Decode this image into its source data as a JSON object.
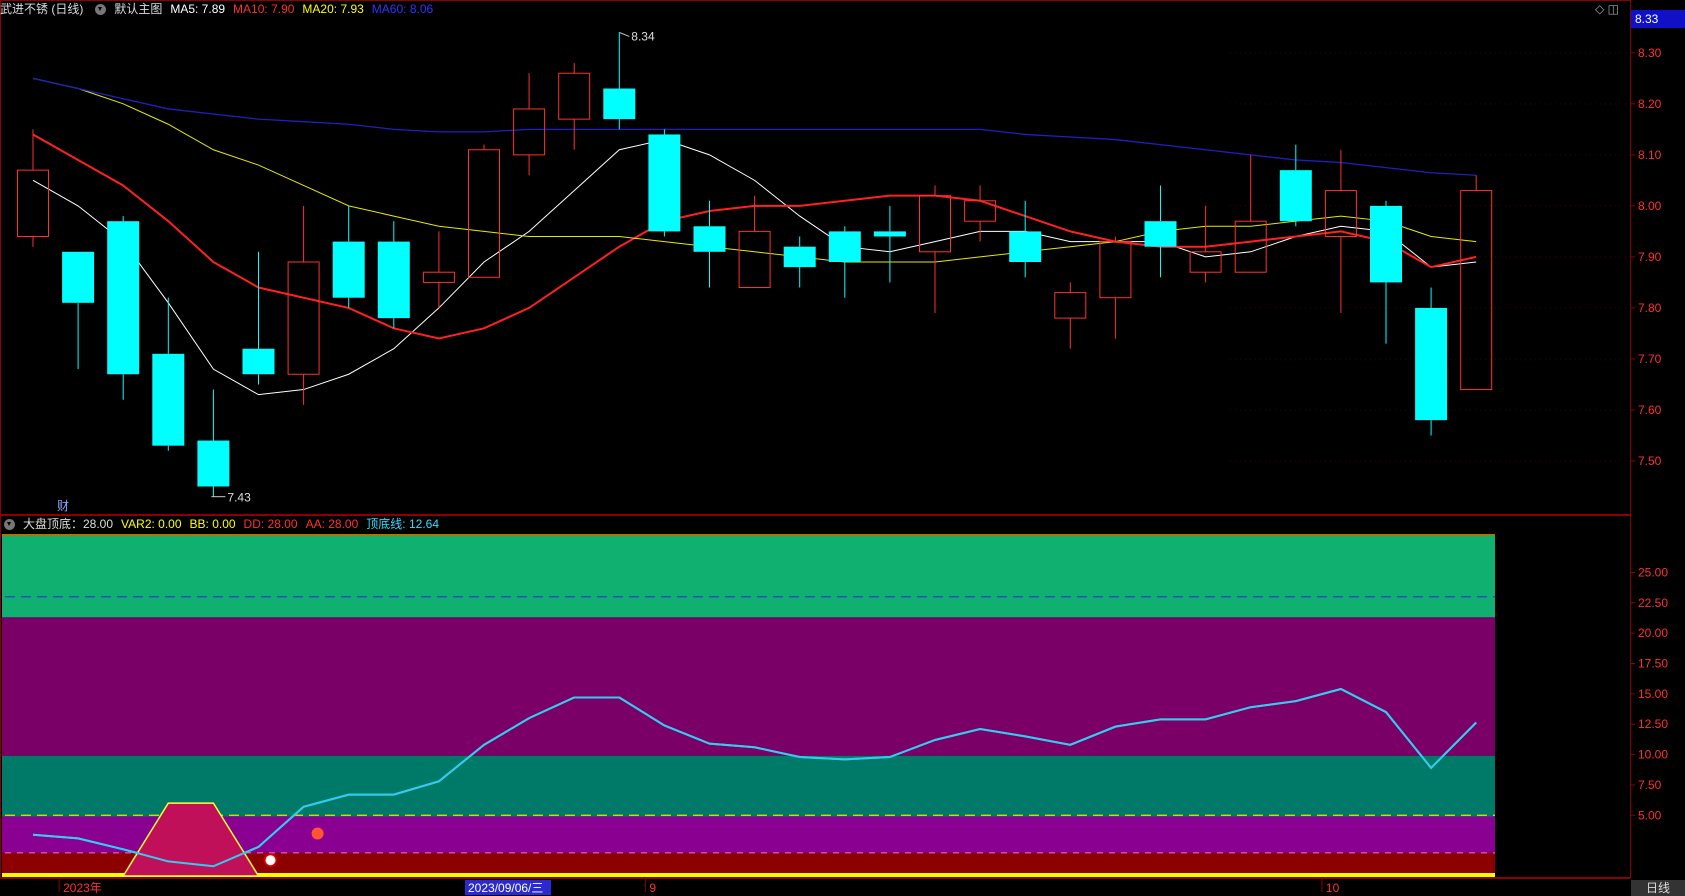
{
  "main_header": {
    "stock": "武进不锈 (日线)",
    "chart_name": "默认主图",
    "indicators": [
      {
        "label": "MA5: 7.89",
        "color": "#ffffff"
      },
      {
        "label": "MA10: 7.90",
        "color": "#ff3030"
      },
      {
        "label": "MA20: 7.93",
        "color": "#ffff00"
      },
      {
        "label": "MA60: 8.06",
        "color": "#3333ff"
      }
    ]
  },
  "sub_header": {
    "name": "大盘顶底：28.00",
    "indicators": [
      {
        "label": "VAR2: 0.00",
        "color": "#ffff00"
      },
      {
        "label": "BB: 0.00",
        "color": "#ffff00"
      },
      {
        "label": "DD: 28.00",
        "color": "#ff3030"
      },
      {
        "label": "AA: 28.00",
        "color": "#ff3030"
      },
      {
        "label": "顶底线: 12.64",
        "color": "#33ddff"
      }
    ]
  },
  "top_right_icons": "◇ ◫",
  "current_price_tag": "8.33",
  "bottom_right_label": "日线",
  "cai_label": "财",
  "colors": {
    "up": "#ff3030",
    "down": "#00ffff",
    "ma5": "#ffffff",
    "ma10": "#ff2020",
    "ma20": "#e8e800",
    "ma60": "#2020c0",
    "osc_line": "#33ccee",
    "band_top": "#10b070",
    "band_purple": "#7a0068",
    "band_teal": "#007a68",
    "band_magenta": "#8a0090",
    "band_bottom": "#8c0000"
  },
  "chart_data": [
    {
      "type": "candlestick",
      "title": "",
      "y_ticks": [
        "8.30",
        "8.20",
        "8.10",
        "8.00",
        "7.90",
        "7.80",
        "7.70",
        "7.60",
        "7.50"
      ],
      "ylim": [
        7.4,
        8.38
      ],
      "annotations": {
        "high": "8.34",
        "low": "7.43"
      },
      "candles": [
        {
          "o": 7.94,
          "h": 8.15,
          "l": 7.92,
          "c": 8.07
        },
        {
          "o": 7.91,
          "h": 7.91,
          "l": 7.68,
          "c": 7.81
        },
        {
          "o": 7.97,
          "h": 7.98,
          "l": 7.62,
          "c": 7.67
        },
        {
          "o": 7.71,
          "h": 7.82,
          "l": 7.52,
          "c": 7.53
        },
        {
          "o": 7.54,
          "h": 7.64,
          "l": 7.43,
          "c": 7.45
        },
        {
          "o": 7.72,
          "h": 7.91,
          "l": 7.65,
          "c": 7.67
        },
        {
          "o": 7.67,
          "h": 8.0,
          "l": 7.61,
          "c": 7.89
        },
        {
          "o": 7.93,
          "h": 8.0,
          "l": 7.8,
          "c": 7.82
        },
        {
          "o": 7.93,
          "h": 7.97,
          "l": 7.76,
          "c": 7.78
        },
        {
          "o": 7.85,
          "h": 7.95,
          "l": 7.8,
          "c": 7.87
        },
        {
          "o": 7.86,
          "h": 8.12,
          "l": 7.86,
          "c": 8.11
        },
        {
          "o": 8.1,
          "h": 8.26,
          "l": 8.06,
          "c": 8.19
        },
        {
          "o": 8.17,
          "h": 8.28,
          "l": 8.11,
          "c": 8.26
        },
        {
          "o": 8.23,
          "h": 8.34,
          "l": 8.15,
          "c": 8.17
        },
        {
          "o": 8.14,
          "h": 8.15,
          "l": 7.94,
          "c": 7.95
        },
        {
          "o": 7.96,
          "h": 8.01,
          "l": 7.84,
          "c": 7.91
        },
        {
          "o": 7.84,
          "h": 8.02,
          "l": 7.84,
          "c": 7.95
        },
        {
          "o": 7.92,
          "h": 7.94,
          "l": 7.84,
          "c": 7.88
        },
        {
          "o": 7.95,
          "h": 7.96,
          "l": 7.82,
          "c": 7.89
        },
        {
          "o": 7.95,
          "h": 8.0,
          "l": 7.85,
          "c": 7.94
        },
        {
          "o": 7.91,
          "h": 8.04,
          "l": 7.79,
          "c": 8.02
        },
        {
          "o": 7.97,
          "h": 8.04,
          "l": 7.93,
          "c": 8.01
        },
        {
          "o": 7.95,
          "h": 8.01,
          "l": 7.86,
          "c": 7.89
        },
        {
          "o": 7.78,
          "h": 7.85,
          "l": 7.72,
          "c": 7.83
        },
        {
          "o": 7.82,
          "h": 7.94,
          "l": 7.74,
          "c": 7.93
        },
        {
          "o": 7.97,
          "h": 8.04,
          "l": 7.86,
          "c": 7.92
        },
        {
          "o": 7.87,
          "h": 8.0,
          "l": 7.85,
          "c": 7.91
        },
        {
          "o": 7.87,
          "h": 8.1,
          "l": 7.87,
          "c": 7.97
        },
        {
          "o": 8.07,
          "h": 8.12,
          "l": 7.96,
          "c": 7.97
        },
        {
          "o": 7.94,
          "h": 8.11,
          "l": 7.79,
          "c": 8.03
        },
        {
          "o": 8.0,
          "h": 8.01,
          "l": 7.73,
          "c": 7.85
        },
        {
          "o": 7.8,
          "h": 7.84,
          "l": 7.55,
          "c": 7.58
        },
        {
          "o": 7.64,
          "h": 8.06,
          "l": 7.64,
          "c": 8.03
        }
      ],
      "series": [
        {
          "name": "MA5",
          "values": [
            8.05,
            8.0,
            7.93,
            7.81,
            7.68,
            7.63,
            7.64,
            7.67,
            7.72,
            7.8,
            7.89,
            7.95,
            8.03,
            8.11,
            8.13,
            8.1,
            8.05,
            7.98,
            7.92,
            7.91,
            7.93,
            7.95,
            7.95,
            7.93,
            7.93,
            7.93,
            7.9,
            7.91,
            7.94,
            7.96,
            7.95,
            7.88,
            7.89
          ]
        },
        {
          "name": "MA10",
          "values": [
            8.14,
            8.09,
            8.04,
            7.97,
            7.89,
            7.84,
            7.82,
            7.8,
            7.76,
            7.74,
            7.76,
            7.8,
            7.86,
            7.92,
            7.97,
            7.99,
            8.0,
            8.0,
            8.01,
            8.02,
            8.02,
            8.01,
            7.98,
            7.95,
            7.93,
            7.92,
            7.92,
            7.93,
            7.94,
            7.95,
            7.93,
            7.88,
            7.9
          ]
        },
        {
          "name": "MA20",
          "values": [
            8.25,
            8.23,
            8.2,
            8.16,
            8.11,
            8.08,
            8.04,
            8.0,
            7.98,
            7.96,
            7.95,
            7.94,
            7.94,
            7.94,
            7.93,
            7.92,
            7.91,
            7.9,
            7.89,
            7.89,
            7.89,
            7.9,
            7.91,
            7.92,
            7.93,
            7.95,
            7.96,
            7.96,
            7.97,
            7.98,
            7.97,
            7.94,
            7.93
          ]
        },
        {
          "name": "MA60",
          "values": [
            8.25,
            8.23,
            8.21,
            8.19,
            8.18,
            8.17,
            8.165,
            8.16,
            8.15,
            8.145,
            8.145,
            8.15,
            8.15,
            8.15,
            8.15,
            8.15,
            8.15,
            8.15,
            8.15,
            8.15,
            8.15,
            8.15,
            8.14,
            8.135,
            8.13,
            8.12,
            8.11,
            8.1,
            8.09,
            8.085,
            8.075,
            8.065,
            8.06
          ]
        }
      ]
    },
    {
      "type": "line",
      "title": "",
      "y_ticks": [
        "25.00",
        "22.50",
        "20.00",
        "17.50",
        "15.00",
        "12.50",
        "10.00",
        "7.50",
        "5.00"
      ],
      "ylim": [
        0,
        28
      ],
      "bands": [
        {
          "from": 21.3,
          "to": 28,
          "color": "#10b070"
        },
        {
          "from": 9.9,
          "to": 21.3,
          "color": "#7a0068"
        },
        {
          "from": 4.9,
          "to": 9.9,
          "color": "#007a68"
        },
        {
          "from": 1.9,
          "to": 4.9,
          "color": "#8a0090"
        },
        {
          "from": 0,
          "to": 1.9,
          "color": "#8c0000"
        }
      ],
      "ref_lines": [
        23.0,
        5.0,
        1.9
      ],
      "series": [
        {
          "name": "顶底线",
          "values": [
            3.4,
            3.1,
            2.2,
            1.2,
            0.8,
            2.4,
            5.7,
            6.7,
            6.7,
            7.8,
            10.8,
            13.0,
            14.7,
            14.7,
            12.4,
            10.9,
            10.6,
            9.8,
            9.6,
            9.8,
            11.2,
            12.1,
            11.5,
            10.8,
            12.3,
            12.9,
            12.9,
            13.9,
            14.4,
            15.4,
            13.5,
            8.9,
            12.64
          ]
        },
        {
          "name": "VAR2",
          "values": [
            0,
            0,
            0,
            6,
            6,
            0,
            0,
            0,
            0,
            0,
            0,
            0,
            0,
            0,
            0,
            0,
            0,
            0,
            0,
            0,
            0,
            0,
            0,
            0,
            0,
            0,
            0,
            0,
            0,
            0,
            0,
            0,
            0
          ]
        }
      ]
    }
  ],
  "x_axis": {
    "labels": [
      {
        "text": "2023年",
        "index": 1
      },
      {
        "text": "9",
        "index": 14
      },
      {
        "text": "10",
        "index": 29
      }
    ],
    "selected_date": {
      "text": "2023/09/06/三",
      "index": 20
    }
  }
}
